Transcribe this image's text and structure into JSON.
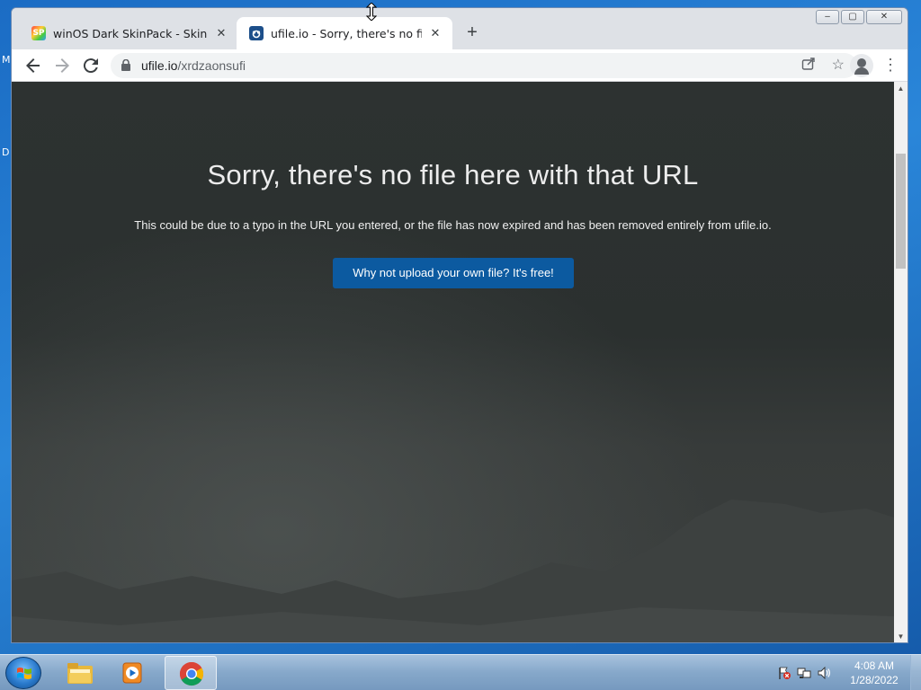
{
  "desktop": {
    "fragments": [
      "M",
      "D"
    ]
  },
  "browser": {
    "tabs": [
      {
        "title": "winOS Dark SkinPack - Skin Pack",
        "favicon": "skinpack-icon",
        "active": false
      },
      {
        "title": "ufile.io - Sorry, there's no file here",
        "favicon": "ufile-icon",
        "active": true
      }
    ],
    "new_tab_label": "+",
    "omnibox": {
      "domain": "ufile.io",
      "path": "/xrdzaonsufi"
    },
    "window_buttons": [
      "minimize",
      "maximize",
      "close"
    ]
  },
  "page": {
    "headline": "Sorry, there's no file here with that URL",
    "message": "This could be due to a typo in the URL you entered, or the file has now expired and has been removed entirely from ufile.io.",
    "cta_label": "Why not upload your own file? It's free!",
    "cta_color": "#0c5aa0"
  },
  "taskbar": {
    "apps": [
      "file-explorer-icon",
      "media-player-icon",
      "chrome-icon"
    ],
    "active_app": "chrome-icon",
    "clock": {
      "time": "4:08 AM",
      "date": "1/28/2022"
    }
  }
}
